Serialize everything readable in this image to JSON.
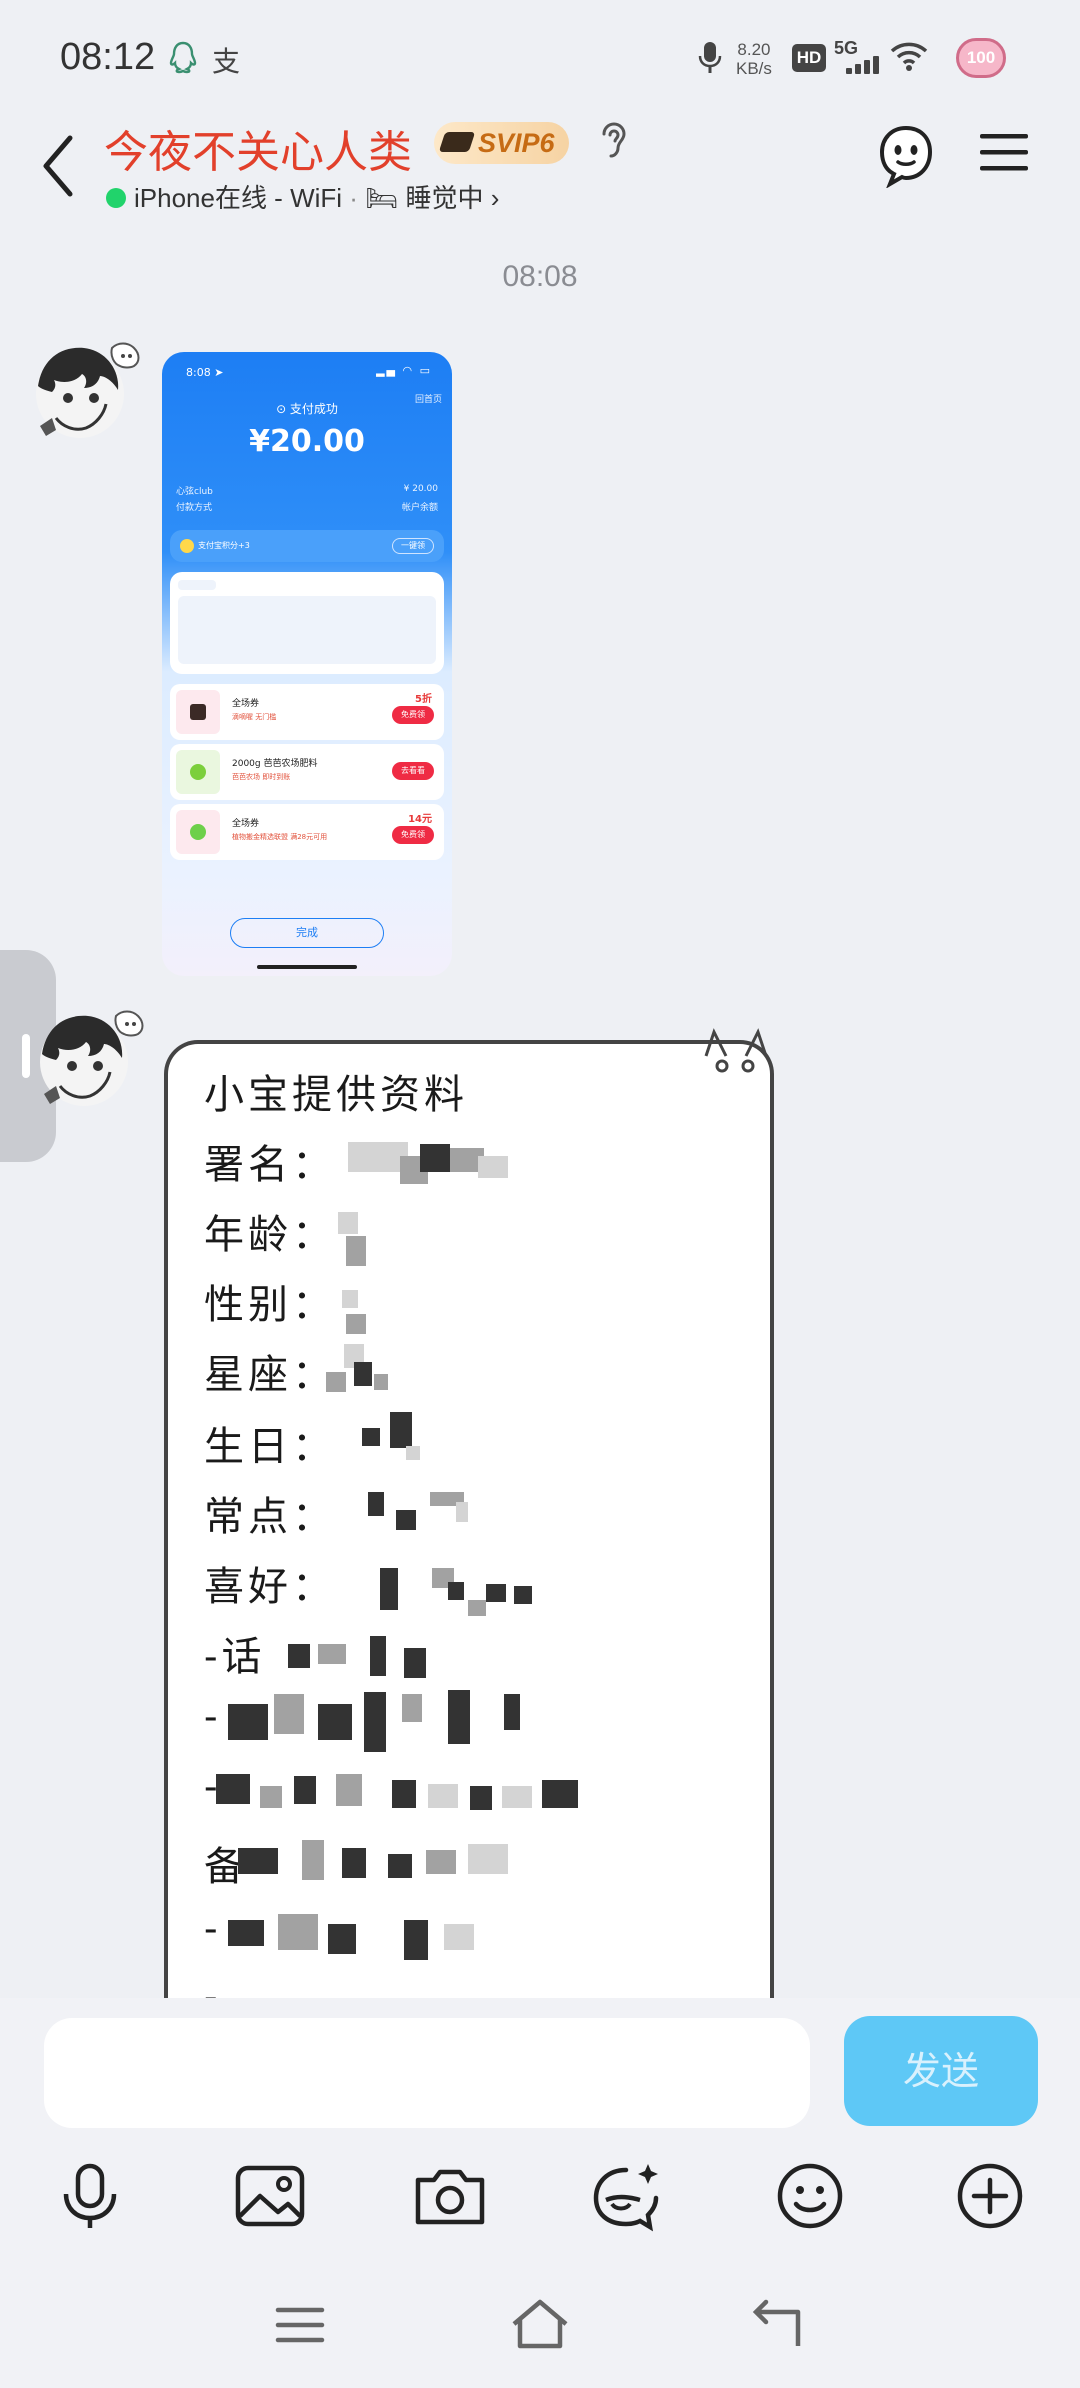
{
  "status_bar": {
    "time": "08:12",
    "net_speed": "8.20",
    "net_unit": "KB/s",
    "hd": "HD",
    "network": "5G",
    "battery": "100"
  },
  "header": {
    "contact_name": "今夜不关心人类",
    "vip_badge": "SVIP6",
    "online_prefix": "iPhone在线 - WiFi",
    "separator": "·",
    "status_emoji": "🛏",
    "status_text": "睡觉中",
    "status_chevron": "›"
  },
  "chat": {
    "timestamp": "08:08",
    "image_message": {
      "phone_time": "8:08 ➤",
      "back_home": "回首页",
      "pay_status": "⊙ 支付成功",
      "amount": "¥20.00",
      "merchant_label": "心弦club",
      "merchant_value": "¥ 20.00",
      "method_label": "付款方式",
      "method_value": "帐户余额",
      "points_text": "支付宝积分+3",
      "points_button": "一键领",
      "coupons": [
        {
          "title": "全场券",
          "sub": "滴嘀喔  无门槛",
          "value": "5折",
          "button": "免费领",
          "color": "#3b2a26"
        },
        {
          "title": "2000g 芭芭农场肥料",
          "sub": "芭芭农场  即时到账",
          "value": "",
          "button": "去看看",
          "color": "#7ccf3c"
        },
        {
          "title": "全场券",
          "sub": "植物搬金精选联盟  满28元可用",
          "value": "14元",
          "button": "免费领",
          "color": "#6ed04a"
        }
      ],
      "done_button": "完成"
    },
    "note_card": {
      "title": "小宝提供资料",
      "fields": [
        "署名：",
        "年龄：",
        "性别：",
        "星座：",
        "生日：",
        "常点：",
        "喜好："
      ],
      "list_lines": [
        "-话",
        "-",
        "-",
        "备",
        "-",
        "-"
      ]
    }
  },
  "input": {
    "placeholder": "",
    "send_label": "发送"
  },
  "toolbar": [
    "microphone-icon",
    "image-icon",
    "camera-icon",
    "sticker-icon",
    "emoji-icon",
    "plus-icon"
  ],
  "colors": {
    "name_red": "#e2402b",
    "send_blue": "#5ec8f6",
    "online_green": "#21d36b",
    "pay_blue": "#1d7ef4"
  }
}
